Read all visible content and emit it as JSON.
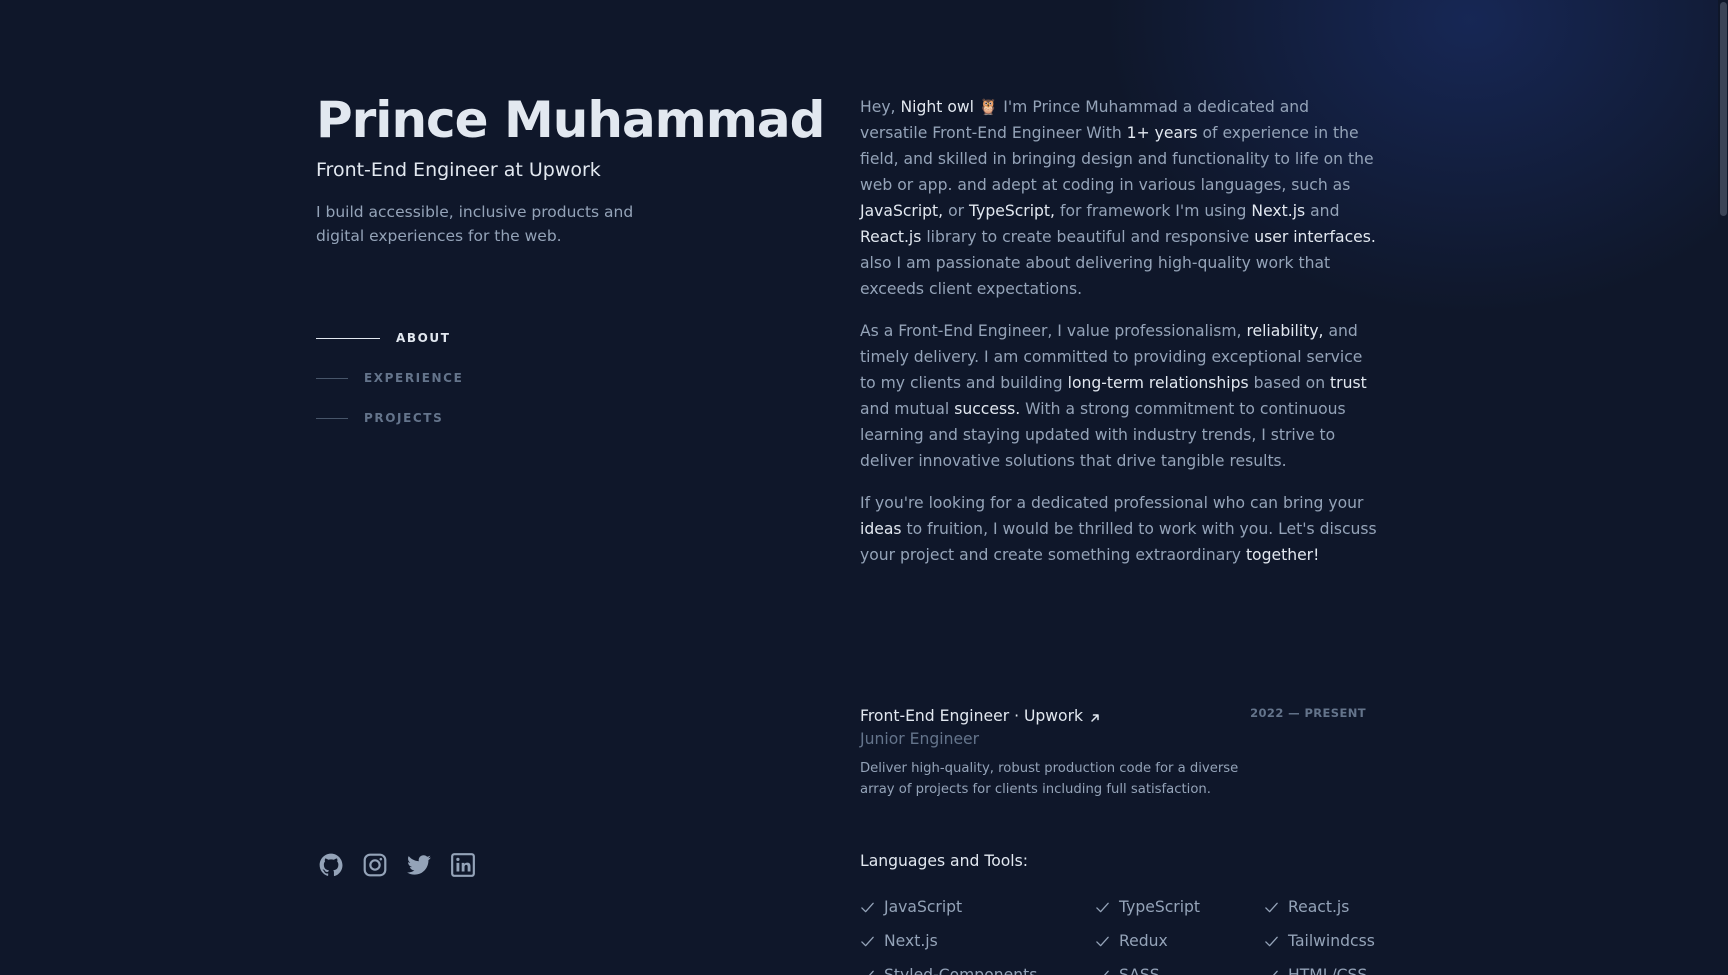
{
  "header": {
    "name": "Prince Muhammad",
    "role": "Front-End Engineer at Upwork",
    "tagline": "I build accessible, inclusive products and digital experiences for the web."
  },
  "nav": {
    "items": [
      {
        "label": "ABOUT",
        "active": true
      },
      {
        "label": "EXPERIENCE",
        "active": false
      },
      {
        "label": "PROJECTS",
        "active": false
      }
    ]
  },
  "socials": [
    {
      "name": "github-icon"
    },
    {
      "name": "instagram-icon"
    },
    {
      "name": "twitter-icon"
    },
    {
      "name": "linkedin-icon"
    }
  ],
  "about": {
    "p1": [
      "Hey, ",
      "Night owl",
      " 🦉 I'm Prince Muhammad a dedicated and versatile Front-End Engineer With ",
      "1+ years",
      " of experience in the field, and skilled in bringing design and functionality to life on the web or app. and adept at coding in various languages, such as ",
      "JavaScript,",
      " or ",
      "TypeScript,",
      " for framework I'm using ",
      "Next.js",
      " and ",
      "React.js",
      " library to create beautiful and responsive ",
      "user interfaces.",
      " also I am passionate about delivering high-quality work that exceeds client expectations."
    ],
    "p2": [
      "As a Front-End Engineer, I value professionalism, ",
      "reliability,",
      " and timely delivery. I am committed to providing exceptional service to my clients and building ",
      "long-term relationships",
      " based on ",
      "trust",
      " and mutual ",
      "success.",
      " With a strong commitment to continuous learning and staying updated with industry trends, I strive to deliver innovative solutions that drive tangible results."
    ],
    "p3": [
      "If you're looking for a dedicated professional who can bring your ",
      "ideas",
      " to fruition, I would be thrilled to work with you. Let's discuss your project and create something extraordinary ",
      "together!"
    ]
  },
  "experience": {
    "range": "2022 — PRESENT",
    "title": "Front-End Engineer · Upwork",
    "subtitle": "Junior Engineer",
    "description": "Deliver high-quality, robust production code for a diverse array of projects for clients including full satisfaction."
  },
  "tools": {
    "heading": "Languages and Tools:",
    "items": [
      "JavaScript",
      "TypeScript",
      "React.js",
      "Next.js",
      "Redux",
      "Tailwindcss",
      "Styled-Components",
      "SASS",
      "HTML/CSS"
    ]
  },
  "colors": {
    "background": "#0f172a",
    "text_primary": "#e2e8f0",
    "text_secondary": "#94a3b8",
    "text_muted": "#64748b"
  }
}
